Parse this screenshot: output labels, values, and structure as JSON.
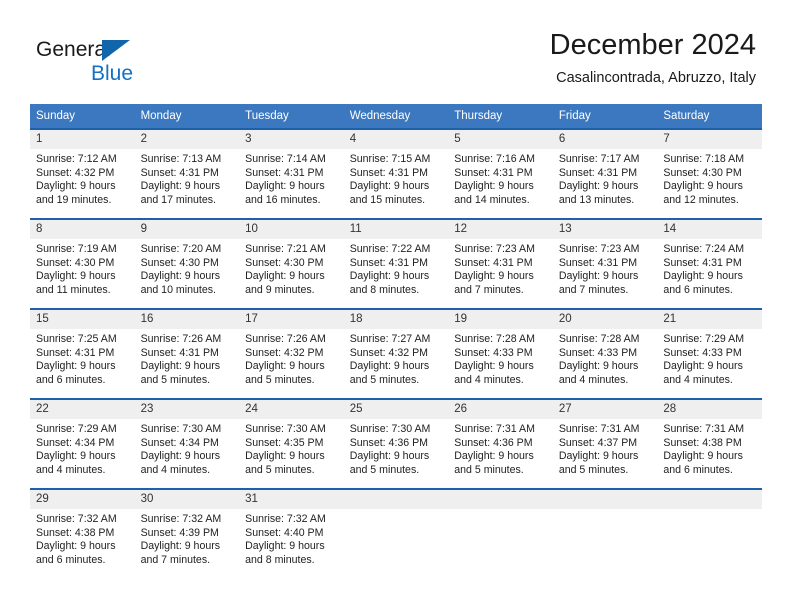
{
  "brand": {
    "name_part1": "General",
    "name_part2": "Blue",
    "triangle_color": "#1065ab",
    "blue_text_color": "#1271c4"
  },
  "header": {
    "title": "December 2024",
    "subtitle": "Casalincontrada, Abruzzo, Italy"
  },
  "colors": {
    "header_bar": "#3b78bf",
    "row_divider": "#1f60a8",
    "daynum_band": "#efefef",
    "page_background": "#ffffff"
  },
  "weekday_headers": [
    "Sunday",
    "Monday",
    "Tuesday",
    "Wednesday",
    "Thursday",
    "Friday",
    "Saturday"
  ],
  "weeks": [
    [
      {
        "day": "1",
        "sunrise": "Sunrise: 7:12 AM",
        "sunset": "Sunset: 4:32 PM",
        "daylight_line1": "Daylight: 9 hours",
        "daylight_line2": "and 19 minutes."
      },
      {
        "day": "2",
        "sunrise": "Sunrise: 7:13 AM",
        "sunset": "Sunset: 4:31 PM",
        "daylight_line1": "Daylight: 9 hours",
        "daylight_line2": "and 17 minutes."
      },
      {
        "day": "3",
        "sunrise": "Sunrise: 7:14 AM",
        "sunset": "Sunset: 4:31 PM",
        "daylight_line1": "Daylight: 9 hours",
        "daylight_line2": "and 16 minutes."
      },
      {
        "day": "4",
        "sunrise": "Sunrise: 7:15 AM",
        "sunset": "Sunset: 4:31 PM",
        "daylight_line1": "Daylight: 9 hours",
        "daylight_line2": "and 15 minutes."
      },
      {
        "day": "5",
        "sunrise": "Sunrise: 7:16 AM",
        "sunset": "Sunset: 4:31 PM",
        "daylight_line1": "Daylight: 9 hours",
        "daylight_line2": "and 14 minutes."
      },
      {
        "day": "6",
        "sunrise": "Sunrise: 7:17 AM",
        "sunset": "Sunset: 4:31 PM",
        "daylight_line1": "Daylight: 9 hours",
        "daylight_line2": "and 13 minutes."
      },
      {
        "day": "7",
        "sunrise": "Sunrise: 7:18 AM",
        "sunset": "Sunset: 4:30 PM",
        "daylight_line1": "Daylight: 9 hours",
        "daylight_line2": "and 12 minutes."
      }
    ],
    [
      {
        "day": "8",
        "sunrise": "Sunrise: 7:19 AM",
        "sunset": "Sunset: 4:30 PM",
        "daylight_line1": "Daylight: 9 hours",
        "daylight_line2": "and 11 minutes."
      },
      {
        "day": "9",
        "sunrise": "Sunrise: 7:20 AM",
        "sunset": "Sunset: 4:30 PM",
        "daylight_line1": "Daylight: 9 hours",
        "daylight_line2": "and 10 minutes."
      },
      {
        "day": "10",
        "sunrise": "Sunrise: 7:21 AM",
        "sunset": "Sunset: 4:30 PM",
        "daylight_line1": "Daylight: 9 hours",
        "daylight_line2": "and 9 minutes."
      },
      {
        "day": "11",
        "sunrise": "Sunrise: 7:22 AM",
        "sunset": "Sunset: 4:31 PM",
        "daylight_line1": "Daylight: 9 hours",
        "daylight_line2": "and 8 minutes."
      },
      {
        "day": "12",
        "sunrise": "Sunrise: 7:23 AM",
        "sunset": "Sunset: 4:31 PM",
        "daylight_line1": "Daylight: 9 hours",
        "daylight_line2": "and 7 minutes."
      },
      {
        "day": "13",
        "sunrise": "Sunrise: 7:23 AM",
        "sunset": "Sunset: 4:31 PM",
        "daylight_line1": "Daylight: 9 hours",
        "daylight_line2": "and 7 minutes."
      },
      {
        "day": "14",
        "sunrise": "Sunrise: 7:24 AM",
        "sunset": "Sunset: 4:31 PM",
        "daylight_line1": "Daylight: 9 hours",
        "daylight_line2": "and 6 minutes."
      }
    ],
    [
      {
        "day": "15",
        "sunrise": "Sunrise: 7:25 AM",
        "sunset": "Sunset: 4:31 PM",
        "daylight_line1": "Daylight: 9 hours",
        "daylight_line2": "and 6 minutes."
      },
      {
        "day": "16",
        "sunrise": "Sunrise: 7:26 AM",
        "sunset": "Sunset: 4:31 PM",
        "daylight_line1": "Daylight: 9 hours",
        "daylight_line2": "and 5 minutes."
      },
      {
        "day": "17",
        "sunrise": "Sunrise: 7:26 AM",
        "sunset": "Sunset: 4:32 PM",
        "daylight_line1": "Daylight: 9 hours",
        "daylight_line2": "and 5 minutes."
      },
      {
        "day": "18",
        "sunrise": "Sunrise: 7:27 AM",
        "sunset": "Sunset: 4:32 PM",
        "daylight_line1": "Daylight: 9 hours",
        "daylight_line2": "and 5 minutes."
      },
      {
        "day": "19",
        "sunrise": "Sunrise: 7:28 AM",
        "sunset": "Sunset: 4:33 PM",
        "daylight_line1": "Daylight: 9 hours",
        "daylight_line2": "and 4 minutes."
      },
      {
        "day": "20",
        "sunrise": "Sunrise: 7:28 AM",
        "sunset": "Sunset: 4:33 PM",
        "daylight_line1": "Daylight: 9 hours",
        "daylight_line2": "and 4 minutes."
      },
      {
        "day": "21",
        "sunrise": "Sunrise: 7:29 AM",
        "sunset": "Sunset: 4:33 PM",
        "daylight_line1": "Daylight: 9 hours",
        "daylight_line2": "and 4 minutes."
      }
    ],
    [
      {
        "day": "22",
        "sunrise": "Sunrise: 7:29 AM",
        "sunset": "Sunset: 4:34 PM",
        "daylight_line1": "Daylight: 9 hours",
        "daylight_line2": "and 4 minutes."
      },
      {
        "day": "23",
        "sunrise": "Sunrise: 7:30 AM",
        "sunset": "Sunset: 4:34 PM",
        "daylight_line1": "Daylight: 9 hours",
        "daylight_line2": "and 4 minutes."
      },
      {
        "day": "24",
        "sunrise": "Sunrise: 7:30 AM",
        "sunset": "Sunset: 4:35 PM",
        "daylight_line1": "Daylight: 9 hours",
        "daylight_line2": "and 5 minutes."
      },
      {
        "day": "25",
        "sunrise": "Sunrise: 7:30 AM",
        "sunset": "Sunset: 4:36 PM",
        "daylight_line1": "Daylight: 9 hours",
        "daylight_line2": "and 5 minutes."
      },
      {
        "day": "26",
        "sunrise": "Sunrise: 7:31 AM",
        "sunset": "Sunset: 4:36 PM",
        "daylight_line1": "Daylight: 9 hours",
        "daylight_line2": "and 5 minutes."
      },
      {
        "day": "27",
        "sunrise": "Sunrise: 7:31 AM",
        "sunset": "Sunset: 4:37 PM",
        "daylight_line1": "Daylight: 9 hours",
        "daylight_line2": "and 5 minutes."
      },
      {
        "day": "28",
        "sunrise": "Sunrise: 7:31 AM",
        "sunset": "Sunset: 4:38 PM",
        "daylight_line1": "Daylight: 9 hours",
        "daylight_line2": "and 6 minutes."
      }
    ],
    [
      {
        "day": "29",
        "sunrise": "Sunrise: 7:32 AM",
        "sunset": "Sunset: 4:38 PM",
        "daylight_line1": "Daylight: 9 hours",
        "daylight_line2": "and 6 minutes."
      },
      {
        "day": "30",
        "sunrise": "Sunrise: 7:32 AM",
        "sunset": "Sunset: 4:39 PM",
        "daylight_line1": "Daylight: 9 hours",
        "daylight_line2": "and 7 minutes."
      },
      {
        "day": "31",
        "sunrise": "Sunrise: 7:32 AM",
        "sunset": "Sunset: 4:40 PM",
        "daylight_line1": "Daylight: 9 hours",
        "daylight_line2": "and 8 minutes."
      },
      {
        "day": "",
        "sunrise": "",
        "sunset": "",
        "daylight_line1": "",
        "daylight_line2": ""
      },
      {
        "day": "",
        "sunrise": "",
        "sunset": "",
        "daylight_line1": "",
        "daylight_line2": ""
      },
      {
        "day": "",
        "sunrise": "",
        "sunset": "",
        "daylight_line1": "",
        "daylight_line2": ""
      },
      {
        "day": "",
        "sunrise": "",
        "sunset": "",
        "daylight_line1": "",
        "daylight_line2": ""
      }
    ]
  ]
}
